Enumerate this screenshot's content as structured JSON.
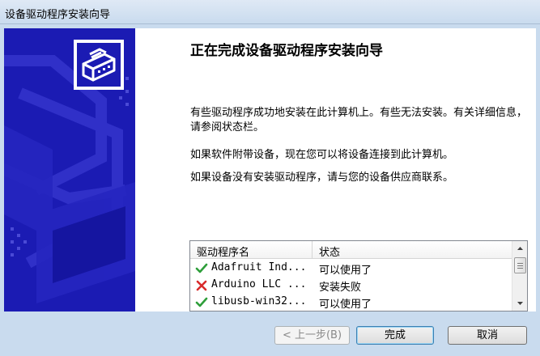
{
  "window": {
    "title": "设备驱动程序安装向导"
  },
  "main": {
    "heading": "正在完成设备驱动程序安装向导",
    "paragraph1": "有些驱动程序成功地安装在此计算机上。有些无法安装。有关详细信息，请参阅状态栏。",
    "paragraph2": "如果软件附带设备，现在您可以将设备连接到此计算机。",
    "paragraph3": "如果设备没有安装驱动程序，请与您的设备供应商联系。"
  },
  "driver_list": {
    "columns": [
      "驱动程序名",
      "状态"
    ],
    "rows": [
      {
        "name": "Adafruit Ind...",
        "status": "可以使用了",
        "icon": "check-icon",
        "color": "#2e9e3a"
      },
      {
        "name": "Arduino LLC ...",
        "status": "安装失败",
        "icon": "x-icon",
        "color": "#d82a2a"
      },
      {
        "name": "libusb-win32...",
        "status": "可以使用了",
        "icon": "check-icon",
        "color": "#2e9e3a"
      }
    ]
  },
  "buttons": {
    "back": "< 上一步(B)",
    "finish": "完成",
    "cancel": "取消"
  },
  "colors": {
    "banner": "#1b1bb3",
    "frame": "#c9dbee"
  }
}
